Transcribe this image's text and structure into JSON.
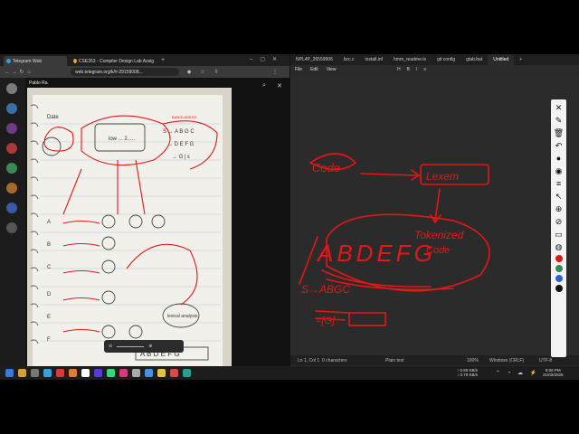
{
  "browser": {
    "tabs": [
      {
        "label": "Telegram Web",
        "color": "#2aa3e0"
      },
      {
        "label": "CSE353 - Compiler Design Lab Assig",
        "color": "#e8a33a"
      }
    ],
    "url": "web.telegram.org/k/#-29159008..."
  },
  "telegram": {
    "chat_name": "Pablo Ra",
    "chat_status": "Yesterday at 11:25",
    "sidebar_dots": [
      "#7a7a7a",
      "#3a6ea5",
      "#6d3a85",
      "#aa3a3a",
      "#3a8a55",
      "#a56a2a",
      "#3a5aa5",
      "#555555"
    ]
  },
  "editor": {
    "tabs": [
      {
        "label": "NPL4P_26559906"
      },
      {
        "label": "bcc.c"
      },
      {
        "label": "install.inf"
      },
      {
        "label": "hmm_readme.tx"
      },
      {
        "label": "git config"
      },
      {
        "label": "gtab.bat"
      },
      {
        "label": "Untitled",
        "active": true
      }
    ],
    "menu": [
      "File",
      "Edit",
      "View"
    ],
    "format": [
      "H",
      "B",
      "I",
      "≡"
    ],
    "status": {
      "position": "Ln 1, Col 1",
      "chars": "0 characters",
      "format": "Plain text",
      "zoom": "100%",
      "line_ending": "Windows (CRLF)",
      "encoding": "UTF-8"
    },
    "drawing": {
      "code": "Code",
      "lexem": "Lexem",
      "tokenized": "Tokenized",
      "code2": "Code",
      "big": "ABDEFG",
      "rule": "S→ABGC",
      "rule2": "=[G]"
    }
  },
  "pen_tools": [
    "✕",
    "✎",
    "🗑",
    "↶",
    "●",
    "◉",
    "≡",
    "↖",
    "⊕",
    "⊘",
    "▭",
    "◍"
  ],
  "taskbar": {
    "net_up": "↑ 0.50 KB/s",
    "net_down": "↓ 0.79 KB/s",
    "time": "8:06 PM",
    "date": "21/02/2025",
    "icons": [
      "#3a7bd5",
      "#d5a13a",
      "#777777",
      "#3aa0d5",
      "#d53a3a",
      "#e07b39",
      "#ffffff",
      "#5a3ad5",
      "#3ad57b",
      "#d53a7b",
      "#aaaaaa",
      "#4a90e2",
      "#e2c14a",
      "#d54a4a",
      "#2a9d8f"
    ]
  },
  "photo": {
    "notebook_header": "Date",
    "stamp": "BANGLADESH",
    "items": [
      "low ... 2.....",
      "S → A B G C",
      "→ D E F G",
      "→ G | ε",
      "A",
      "B",
      "C",
      "D",
      "E",
      "F",
      "lexical analysis",
      "A B D E F G"
    ]
  }
}
